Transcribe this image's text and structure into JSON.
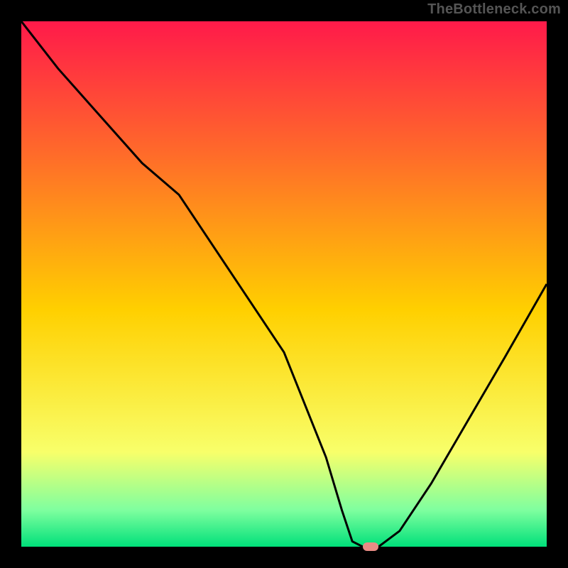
{
  "watermark": "TheBottleneck.com",
  "colors": {
    "gradient_top": "#ff1a4a",
    "gradient_mid_upper": "#ff6a2a",
    "gradient_mid": "#ffd000",
    "gradient_lower": "#f8ff6a",
    "gradient_green_top": "#7fff9f",
    "gradient_green_bottom": "#00e07a",
    "curve": "#000000",
    "marker": "#e98b85",
    "frame": "#000000"
  },
  "chart_data": {
    "type": "line",
    "title": "",
    "xlabel": "",
    "ylabel": "",
    "xlim": [
      0,
      100
    ],
    "ylim": [
      0,
      100
    ],
    "series": [
      {
        "name": "bottleneck-curve",
        "x": [
          0,
          7,
          15,
          23,
          30,
          40,
          50,
          58,
          61,
          63,
          65,
          68,
          72,
          78,
          85,
          92,
          100
        ],
        "values": [
          100,
          91,
          82,
          73,
          67,
          52,
          37,
          17,
          7,
          1,
          0,
          0,
          3,
          12,
          24,
          36,
          50
        ]
      }
    ],
    "marker": {
      "x": 66.5,
      "y": 0
    },
    "annotations": []
  }
}
